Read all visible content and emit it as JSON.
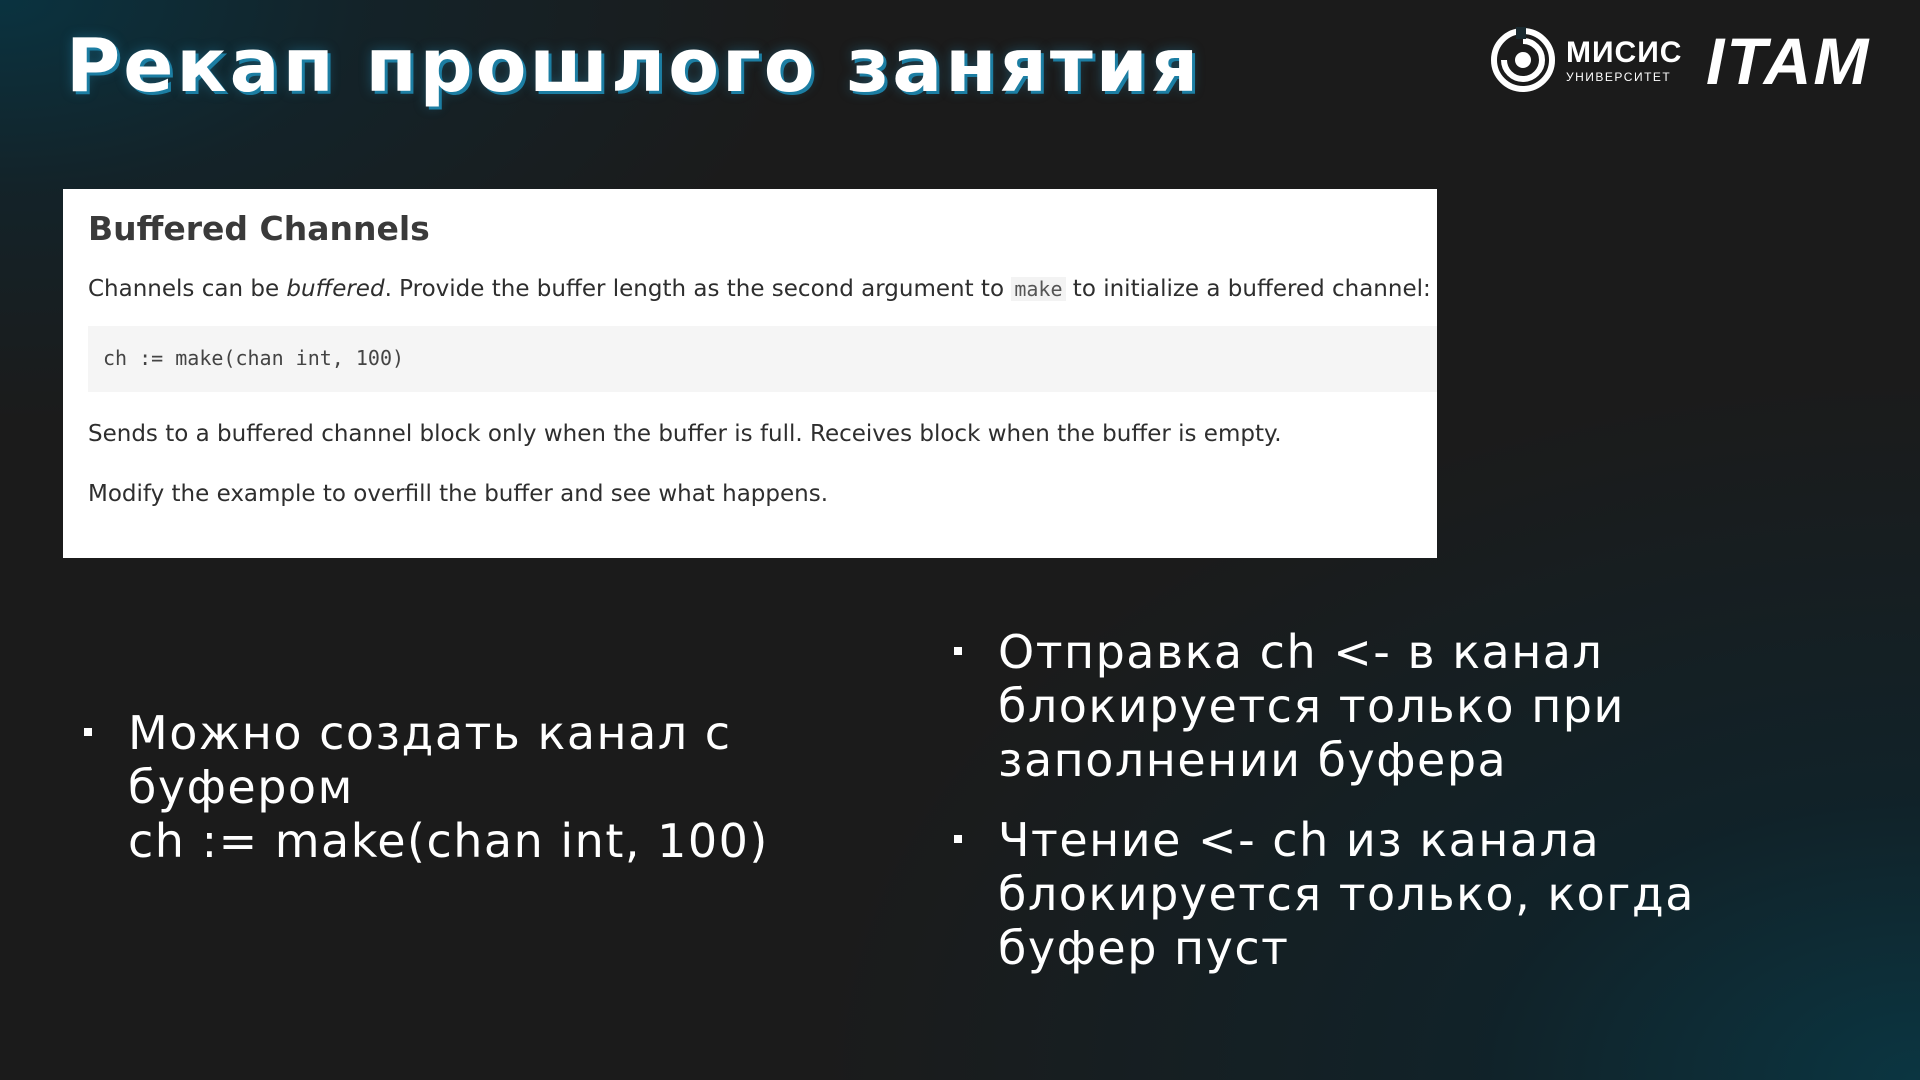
{
  "slide": {
    "title": "Рекап прошлого занятия"
  },
  "logos": {
    "misis_name": "МИСИС",
    "misis_sub": "УНИВЕРСИТЕТ",
    "itam": "ITAM"
  },
  "doc": {
    "heading": "Buffered Channels",
    "p1_before": "Channels can be ",
    "p1_em": "buffered",
    "p1_middle": ". Provide the buffer length as the second argument to ",
    "p1_code": "make",
    "p1_after": " to initialize a buffered channel:",
    "code": "ch := make(chan int, 100)",
    "p2": "Sends to a buffered channel block only when the buffer is full. Receives block when the buffer is empty.",
    "p3": "Modify the example to overfill the buffer and see what happens."
  },
  "bullets_left": [
    {
      "line1": "Можно создать канал с",
      "line2": "буфером",
      "line3": "ch := make(chan int, 100)"
    }
  ],
  "bullets_right": [
    {
      "line1": "Отправка ch <- в канал",
      "line2": "блокируется только при",
      "line3": "заполнении буфера"
    },
    {
      "line1": "Чтение <- ch из канала",
      "line2": "блокируется только, когда",
      "line3": "буфер пуст"
    }
  ]
}
